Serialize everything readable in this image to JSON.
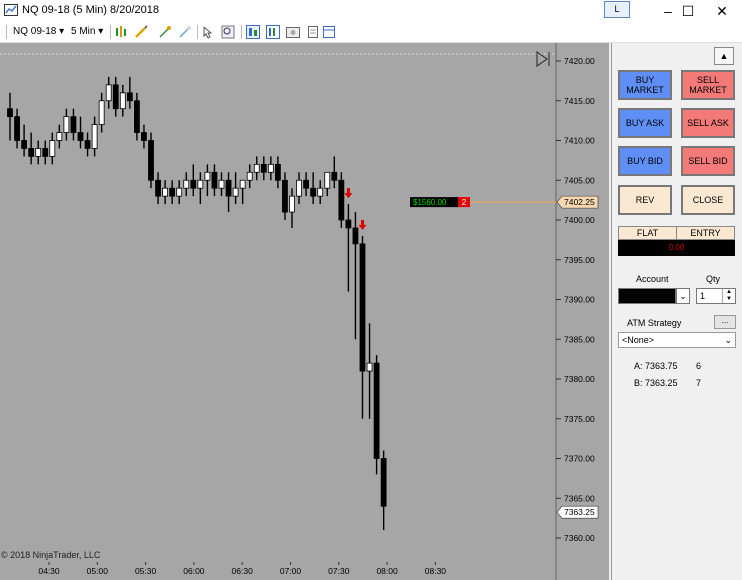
{
  "window": {
    "title": "NQ 09-18 (5 Min)  8/20/2018",
    "layout_btn": "L",
    "minimize": "–",
    "maximize": "☐",
    "close": "✕"
  },
  "toolbar": {
    "instrument": "NQ 09-18",
    "interval": "5 Min"
  },
  "chart": {
    "copyright": "© 2018 NinjaTrader, LLC",
    "price_ticks": [
      "7420.00",
      "7415.00",
      "7410.00",
      "7405.00",
      "7400.00",
      "7395.00",
      "7390.00",
      "7385.00",
      "7380.00",
      "7375.00",
      "7370.00",
      "7365.00",
      "7360.00"
    ],
    "time_ticks": [
      "04:30",
      "05:00",
      "05:30",
      "06:00",
      "06:30",
      "07:00",
      "07:30",
      "08:00",
      "08:30"
    ],
    "last_price_label": "7402.25",
    "current_price_label": "7363.25",
    "position_pnl": "$1560.00",
    "position_qty": "2",
    "colors": {
      "background": "#a6a6a6",
      "up_candle": "#ffffff",
      "down_candle": "#000000",
      "position_line": "#f4a04a",
      "arrow": "#e00000"
    }
  },
  "chart_data": {
    "type": "candlestick",
    "y_range": [
      7358,
      7422
    ],
    "x_labels": [
      "04:30",
      "05:00",
      "05:30",
      "06:00",
      "06:30",
      "07:00",
      "07:30",
      "08:00",
      "08:30"
    ],
    "candles": [
      [
        7414,
        7416,
        7410,
        7413
      ],
      [
        7413,
        7414,
        7409,
        7410
      ],
      [
        7410,
        7412,
        7408,
        7409
      ],
      [
        7409,
        7411,
        7407,
        7408
      ],
      [
        7408,
        7410,
        7407,
        7409
      ],
      [
        7409,
        7410,
        7407,
        7408
      ],
      [
        7408,
        7411,
        7407,
        7410
      ],
      [
        7410,
        7412,
        7409,
        7411
      ],
      [
        7411,
        7414,
        7410,
        7413
      ],
      [
        7413,
        7414,
        7410,
        7411
      ],
      [
        7411,
        7413,
        7409,
        7410
      ],
      [
        7410,
        7411,
        7408,
        7409
      ],
      [
        7409,
        7413,
        7408,
        7412
      ],
      [
        7412,
        7416,
        7411,
        7415
      ],
      [
        7415,
        7418,
        7414,
        7417
      ],
      [
        7417,
        7418,
        7413,
        7414
      ],
      [
        7414,
        7417,
        7413,
        7416
      ],
      [
        7416,
        7418,
        7414,
        7415
      ],
      [
        7415,
        7416,
        7410,
        7411
      ],
      [
        7411,
        7412,
        7409,
        7410
      ],
      [
        7410,
        7411,
        7404,
        7405
      ],
      [
        7405,
        7406,
        7402,
        7403
      ],
      [
        7403,
        7405,
        7402,
        7404
      ],
      [
        7404,
        7405,
        7402,
        7403
      ],
      [
        7403,
        7405,
        7402,
        7404
      ],
      [
        7404,
        7406,
        7403,
        7405
      ],
      [
        7405,
        7407,
        7403,
        7404
      ],
      [
        7404,
        7406,
        7402,
        7405
      ],
      [
        7405,
        7407,
        7403,
        7406
      ],
      [
        7406,
        7407,
        7403,
        7404
      ],
      [
        7404,
        7406,
        7403,
        7405
      ],
      [
        7405,
        7406,
        7401,
        7403
      ],
      [
        7403,
        7406,
        7402,
        7404
      ],
      [
        7404,
        7405,
        7402,
        7405
      ],
      [
        7405,
        7407,
        7404,
        7406
      ],
      [
        7406,
        7408,
        7405,
        7407
      ],
      [
        7407,
        7408,
        7405,
        7406
      ],
      [
        7406,
        7408,
        7405,
        7407
      ],
      [
        7407,
        7408,
        7404,
        7405
      ],
      [
        7405,
        7406,
        7400,
        7401
      ],
      [
        7401,
        7404,
        7399,
        7403
      ],
      [
        7403,
        7406,
        7402,
        7405
      ],
      [
        7405,
        7406,
        7403,
        7404
      ],
      [
        7404,
        7406,
        7402,
        7403
      ],
      [
        7403,
        7405,
        7402,
        7404
      ],
      [
        7404,
        7406,
        7403,
        7406
      ],
      [
        7406,
        7408,
        7404,
        7405
      ],
      [
        7405,
        7406,
        7399,
        7400
      ],
      [
        7400,
        7402,
        7391,
        7399
      ],
      [
        7399,
        7401,
        7385,
        7397
      ],
      [
        7397,
        7398,
        7375,
        7381
      ],
      [
        7381,
        7387,
        7375,
        7382
      ],
      [
        7382,
        7383,
        7368,
        7370
      ],
      [
        7370,
        7371,
        7361,
        7364
      ]
    ],
    "arrows_at_candle": [
      48,
      50
    ]
  },
  "orders": {
    "buy_market": "BUY\nMARKET",
    "sell_market": "SELL\nMARKET",
    "buy_ask": "BUY ASK",
    "sell_ask": "SELL ASK",
    "buy_bid": "BUY BID",
    "sell_bid": "SELL BID",
    "rev": "REV",
    "close": "CLOSE",
    "flat": "FLAT",
    "entry": "ENTRY",
    "pnl": "0.00",
    "account_label": "Account",
    "qty_label": "Qty",
    "qty_value": "1",
    "atm_label": "ATM Strategy",
    "atm_button": "...",
    "atm_value": "<None>",
    "ask_line": "A: 7363.75",
    "ask_size": "6",
    "bid_line": "B: 7363.25",
    "bid_size": "7"
  }
}
